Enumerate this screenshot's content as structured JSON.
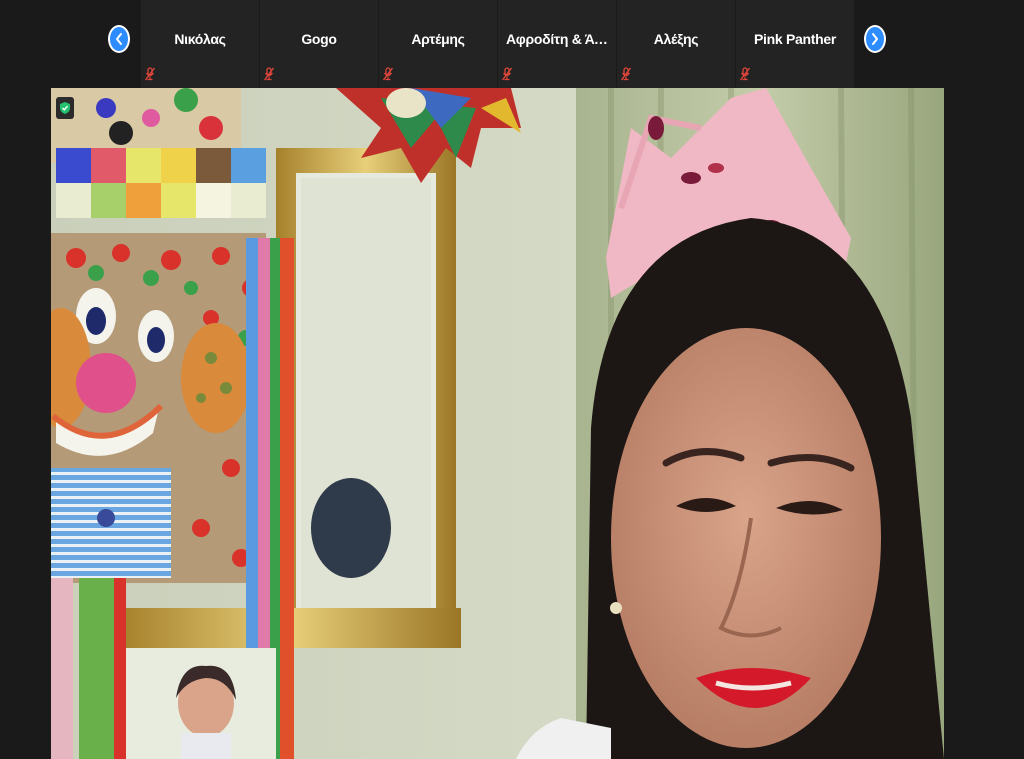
{
  "toolbar": {
    "prev_icon": "chevron-left-icon",
    "next_icon": "chevron-right-icon"
  },
  "participants": [
    {
      "name": "Νικόλας",
      "muted": true
    },
    {
      "name": "Gogo",
      "muted": true
    },
    {
      "name": "Αρτέμης",
      "muted": true
    },
    {
      "name": "Αφροδίτη & Άν...",
      "muted": true
    },
    {
      "name": "Αλέξης",
      "muted": true
    },
    {
      "name": "Pink Panther",
      "muted": true
    }
  ],
  "main_video": {
    "security_icon": "shield-check-icon"
  },
  "colors": {
    "accent": "#2d8cff",
    "background": "#1a1a1a",
    "tile": "#232323",
    "muted_icon": "#e0463b",
    "shield": "#25c16f"
  }
}
